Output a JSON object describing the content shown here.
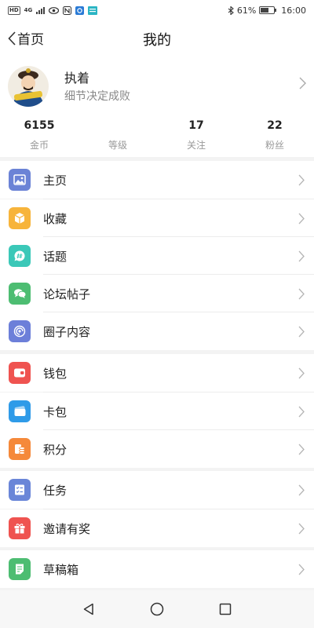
{
  "status_bar": {
    "network_chip_1": "HD",
    "network_chip_2": "4G",
    "battery_percent": "61%",
    "battery_level": 0.61,
    "time": "16:00"
  },
  "header": {
    "back_label": "首页",
    "title": "我的"
  },
  "profile": {
    "name": "执着",
    "signature": "细节决定成败",
    "stats": [
      {
        "value": "6155",
        "label": "金币"
      },
      {
        "value": "",
        "label": "等级"
      },
      {
        "value": "17",
        "label": "关注"
      },
      {
        "value": "22",
        "label": "粉丝"
      }
    ]
  },
  "menu": {
    "group1": [
      {
        "label": "主页",
        "icon": "image-icon",
        "color": "#6b83d6"
      },
      {
        "label": "收藏",
        "icon": "box-icon",
        "color": "#f7b43b"
      },
      {
        "label": "话题",
        "icon": "hashtag-bubble-icon",
        "color": "#3bc8b8"
      },
      {
        "label": "论坛帖子",
        "icon": "chat-bubbles-icon",
        "color": "#4dbd72"
      },
      {
        "label": "圈子内容",
        "icon": "spiral-icon",
        "color": "#6c7fd9"
      }
    ],
    "group2": [
      {
        "label": "钱包",
        "icon": "wallet-icon",
        "color": "#ef5350"
      },
      {
        "label": "卡包",
        "icon": "card-icon",
        "color": "#2f9be8"
      },
      {
        "label": "积分",
        "icon": "coins-icon",
        "color": "#f5893a"
      }
    ],
    "group3": [
      {
        "label": "任务",
        "icon": "task-list-icon",
        "color": "#6a86d8"
      },
      {
        "label": "邀请有奖",
        "icon": "gift-icon",
        "color": "#ef5350"
      }
    ],
    "group4": [
      {
        "label": "草稿箱",
        "icon": "draft-icon",
        "color": "#4dbd72"
      }
    ]
  }
}
